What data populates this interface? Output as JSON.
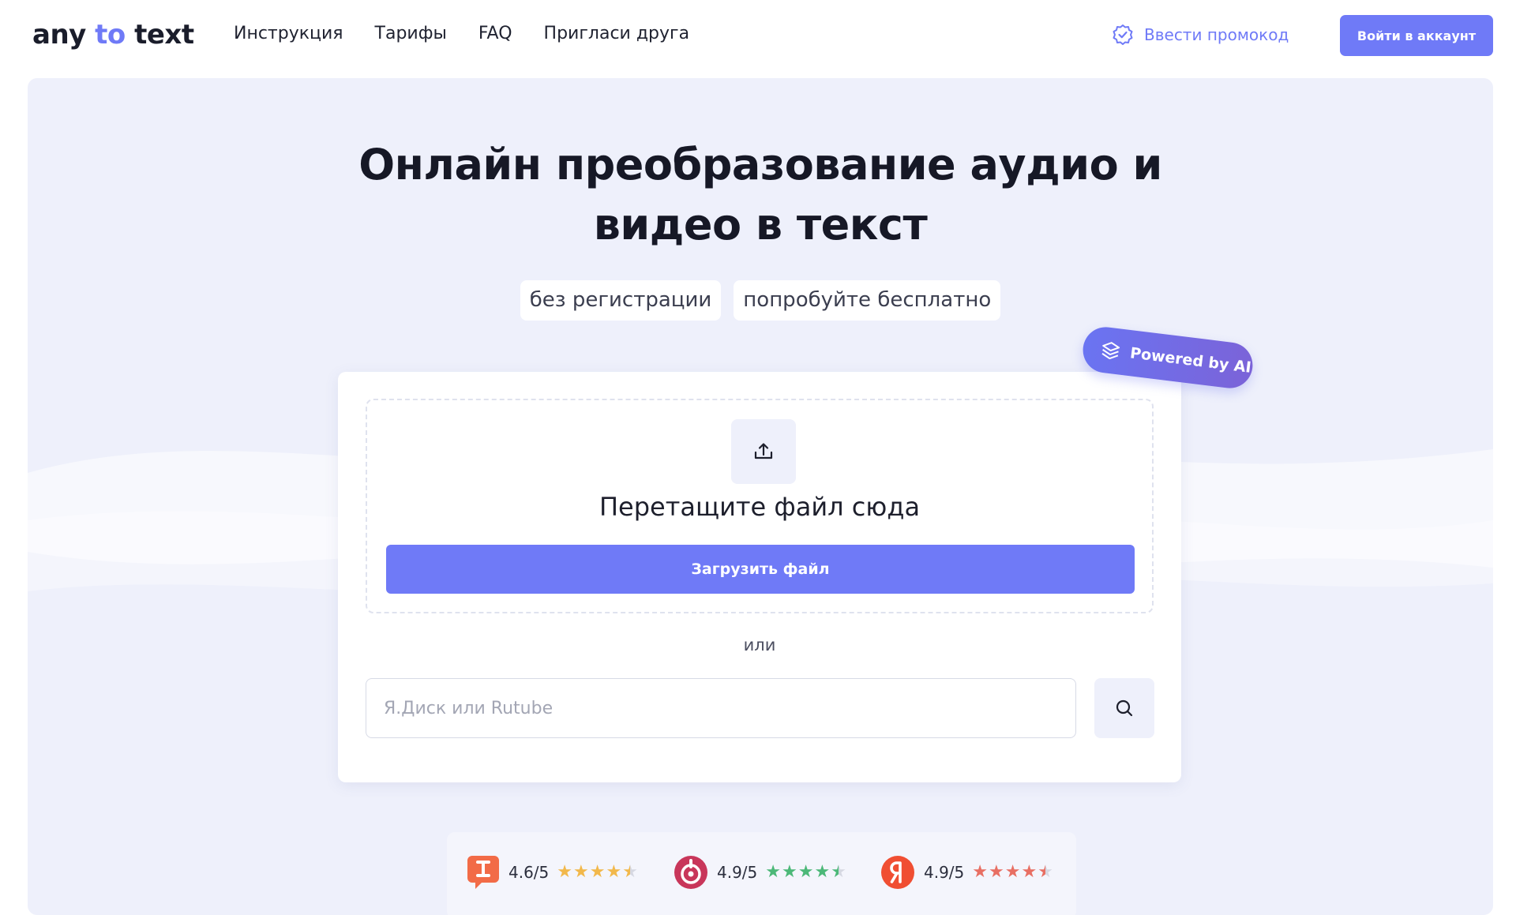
{
  "header": {
    "logo_part1": "any ",
    "logo_part2": "to",
    "logo_part3": " text",
    "nav": [
      "Инструкция",
      "Тарифы",
      "FAQ",
      "Пригласи друга"
    ],
    "promo_label": "Ввести промокод",
    "login_label": "Войти в аккаунт"
  },
  "hero": {
    "title_line1": "Онлайн преобразование аудио и",
    "title_line2": "видео в текст",
    "tags": [
      "без регистрации",
      "попробуйте бесплатно"
    ],
    "badge": "Powered by AI"
  },
  "upload": {
    "drop_text": "Перетащите файл сюда",
    "button_label": "Загрузить файл",
    "or_label": "или",
    "url_placeholder": "Я.Диск или Rutube"
  },
  "ratings": [
    {
      "source_icon": "irecommend-icon",
      "value": "4.6/5",
      "stars": 4.5,
      "color": "#f2b84b"
    },
    {
      "source_icon": "otzovik-icon",
      "value": "4.9/5",
      "stars": 4.5,
      "color": "#4cb878"
    },
    {
      "source_icon": "yandex-icon",
      "value": "4.9/5",
      "stars": 4.5,
      "color": "#e86f63"
    }
  ],
  "colors": {
    "accent": "#6f7af7",
    "hero_bg": "#eef0fb"
  }
}
